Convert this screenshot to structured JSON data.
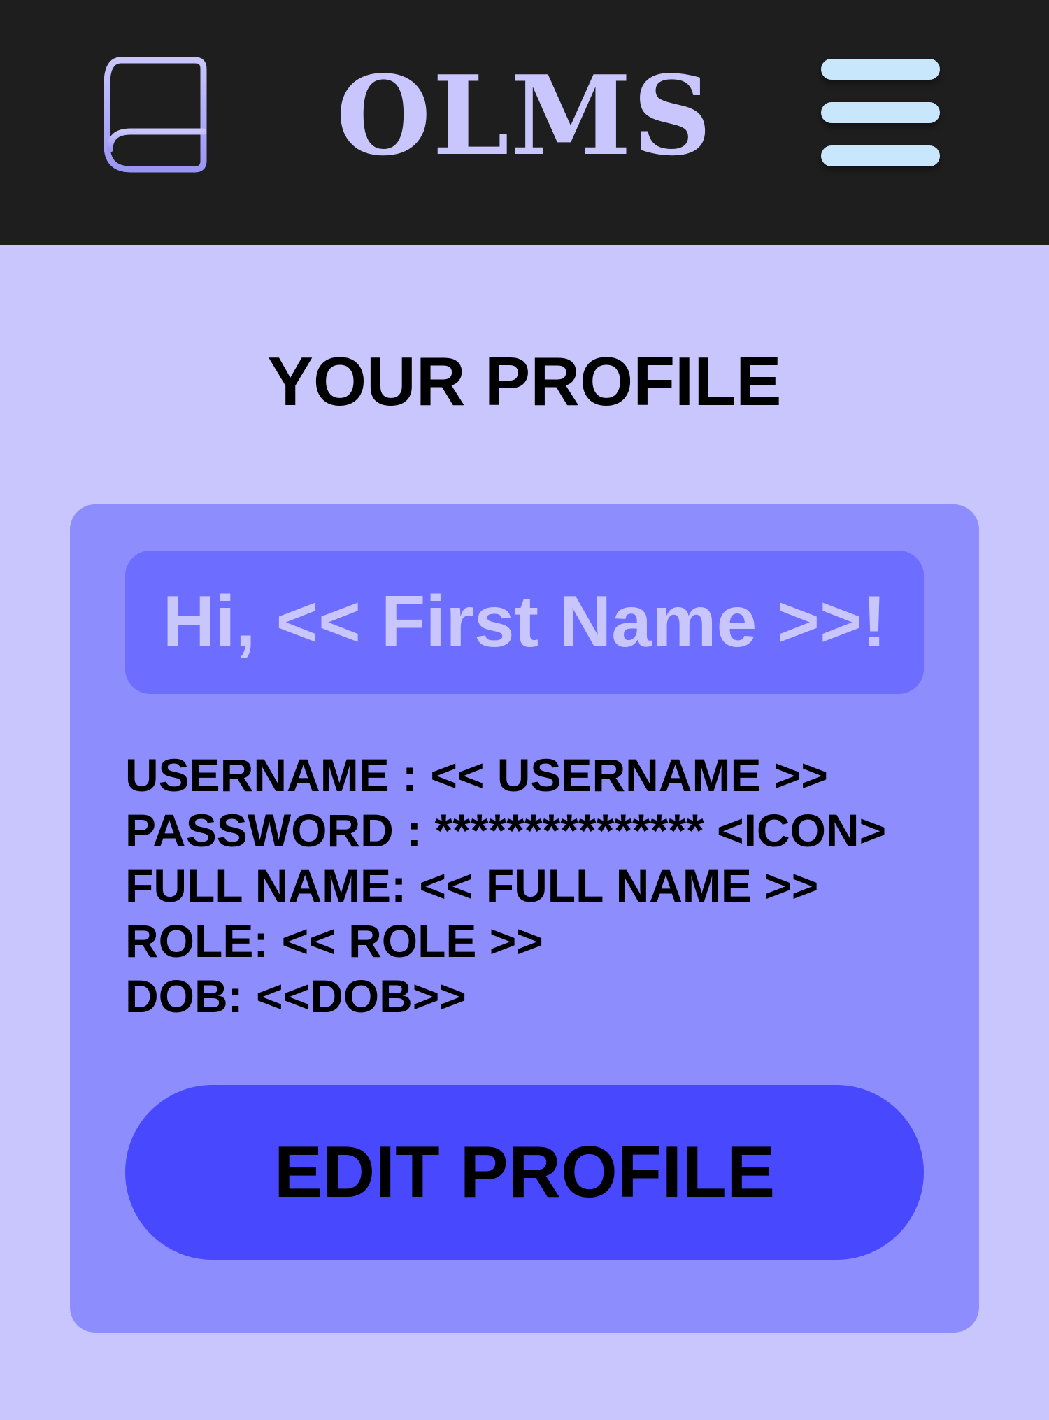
{
  "header": {
    "app_title": "OLMS",
    "logo_icon": "book-icon",
    "menu_icon": "hamburger-menu-icon"
  },
  "page": {
    "title": "YOUR PROFILE"
  },
  "profile": {
    "greeting": "Hi, << First Name >>!",
    "fields": [
      "USERNAME : << USERNAME >>",
      "PASSWORD : *************** <ICON>",
      "FULL NAME: << FULL NAME >>",
      "ROLE: << ROLE >>",
      "DOB: <<DOB>>"
    ],
    "edit_button_label": "EDIT PROFILE"
  },
  "colors": {
    "topbar_bg": "#1e1e1e",
    "page_bg": "#c8c6fc",
    "card_bg": "#8d8dfe",
    "greeting_bg": "#6d6dff",
    "button_bg": "#4848ff",
    "accent_light": "#c8c6fc",
    "menu_bar": "#c9e7fc"
  }
}
